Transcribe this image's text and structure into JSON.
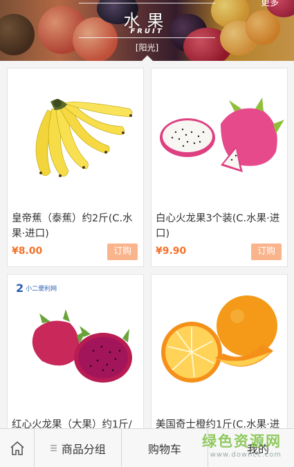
{
  "banner": {
    "title": "水果",
    "subtitle": "FRUIT",
    "tag": "[阳光]",
    "more": "更多"
  },
  "products": [
    {
      "name": "皇帝蕉（泰蕉）约2斤(C.水果·进口)",
      "price": "¥8.00",
      "order_label": "订购",
      "image": "banana-image"
    },
    {
      "name": "白心火龙果3个装(C.水果·进口)",
      "price": "¥9.90",
      "order_label": "订购",
      "image": "white-dragonfruit-image"
    },
    {
      "name": "红心火龙果（大果）约1斤/",
      "price": "",
      "order_label": "",
      "image": "red-dragonfruit-image",
      "logo_text": "小二便利网"
    },
    {
      "name": "美国奇士橙约1斤(C.水果·进",
      "price": "",
      "order_label": "",
      "image": "orange-image"
    }
  ],
  "tabbar": {
    "home_icon": "home-icon",
    "category_label": "商品分组",
    "cart_label": "购物车",
    "mine_label": "我的"
  },
  "watermark": {
    "main": "绿色资源网",
    "url": "www.downcc.com"
  },
  "colors": {
    "price": "#f4722b",
    "order_button": "#f9b48c",
    "watermark": "#7ec143"
  }
}
